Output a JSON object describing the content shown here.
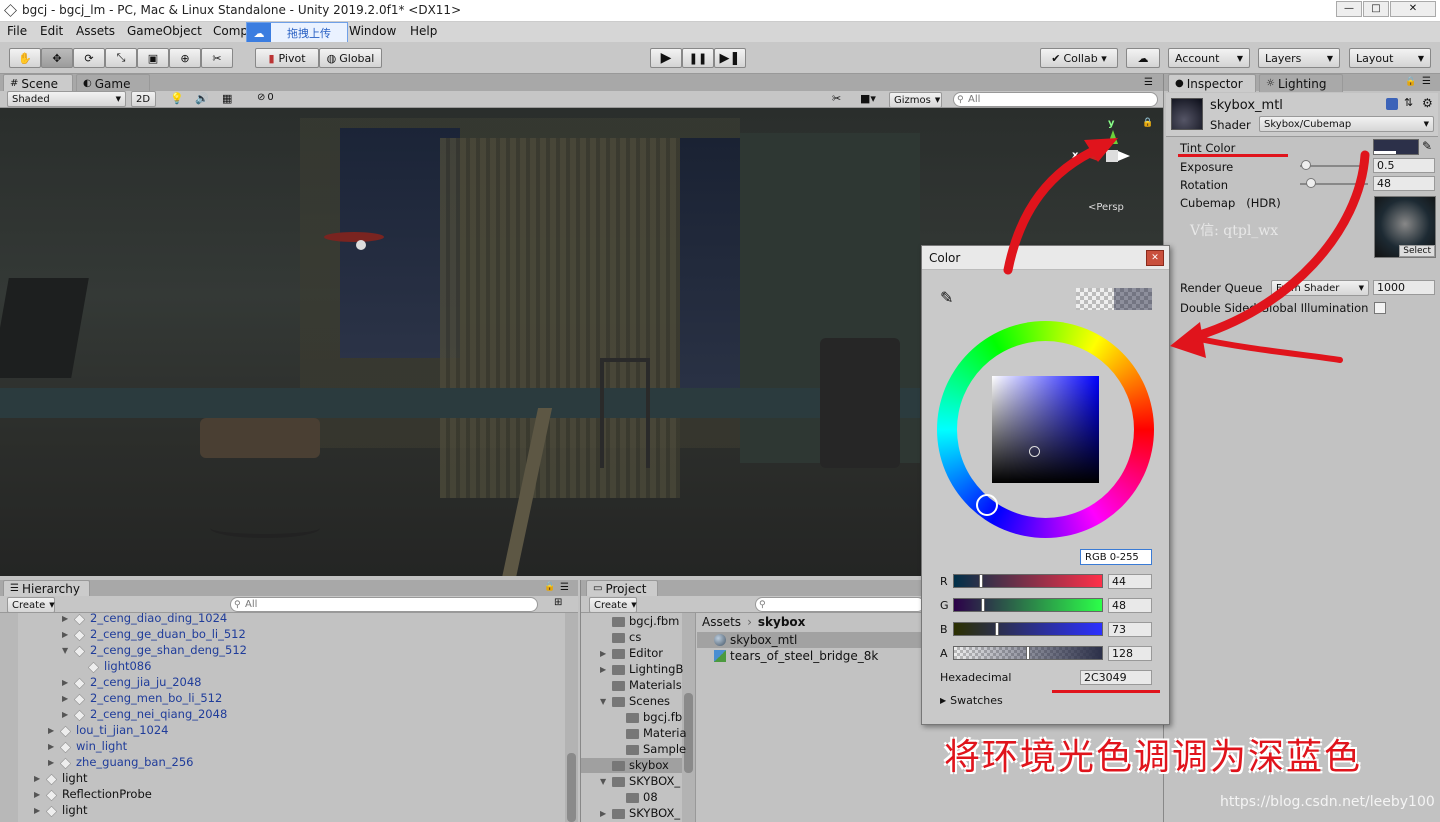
{
  "window": {
    "title": "bgcj - bgcj_lm - PC, Mac & Linux Standalone - Unity 2019.2.0f1* <DX11>",
    "minimize": "—",
    "maximize": "□",
    "close": "✕"
  },
  "menu": {
    "items": [
      "File",
      "Edit",
      "Assets",
      "GameObject",
      "Comp",
      "Window",
      "Help"
    ],
    "upload_badge": "拖拽上传"
  },
  "toolbar": {
    "pivot": "Pivot",
    "global": "Global",
    "collab": "Collab ▾",
    "account": "Account",
    "layers": "Layers",
    "layout": "Layout"
  },
  "scene_panel": {
    "tabs": [
      "Scene",
      "Game"
    ],
    "shading": "Shaded",
    "mode_2d": "2D",
    "hidden_count": "0",
    "gizmos": "Gizmos",
    "search_placeholder": "All",
    "persp": "<Persp",
    "axis_x": "x",
    "axis_y": "y"
  },
  "inspector": {
    "tabs": [
      "Inspector",
      "Lighting"
    ],
    "material_name": "skybox_mtl",
    "shader_label": "Shader",
    "shader_value": "Skybox/Cubemap",
    "props": [
      {
        "label": "Tint Color"
      },
      {
        "label": "Exposure",
        "value": "0.5"
      },
      {
        "label": "Rotation",
        "value": "48"
      },
      {
        "label": "Cubemap   (HDR)"
      }
    ],
    "watermark": "V信: qtpl_wx",
    "select": "Select",
    "render_queue_label": "Render Queue",
    "render_queue_source": "From Shader",
    "render_queue_value": "1000",
    "gi_label": "Double Sided Global Illumination"
  },
  "hierarchy": {
    "tab": "Hierarchy",
    "create": "Create",
    "search_placeholder": "All",
    "items": [
      "2_ceng_diao_ding_1024",
      "2_ceng_ge_duan_bo_li_512",
      "2_ceng_ge_shan_deng_512",
      "light086",
      "2_ceng_jia_ju_2048",
      "2_ceng_men_bo_li_512",
      "2_ceng_nei_qiang_2048",
      "lou_ti_jian_1024",
      "win_light",
      "zhe_guang_ban_256",
      "light",
      "ReflectionProbe",
      "light"
    ]
  },
  "project": {
    "tab": "Project",
    "create": "Create",
    "folders": [
      "bgcj.fbm",
      "cs",
      "Editor",
      "LightingB",
      "Materials",
      "Scenes",
      "bgcj.fb",
      "Materia",
      "Sample",
      "skybox",
      "SKYBOX_",
      "08",
      "SKYBOX_"
    ],
    "breadcrumb_root": "Assets",
    "breadcrumb_current": "skybox",
    "assets": [
      "skybox_mtl",
      "tears_of_steel_bridge_8k"
    ]
  },
  "color_window": {
    "title": "Color",
    "mode": "RGB 0-255",
    "channels": [
      {
        "label": "R",
        "value": "44",
        "fraction": 0.173
      },
      {
        "label": "G",
        "value": "48",
        "fraction": 0.188
      },
      {
        "label": "B",
        "value": "73",
        "fraction": 0.286
      },
      {
        "label": "A",
        "value": "128",
        "fraction": 0.502
      }
    ],
    "hex_label": "Hexadecimal",
    "hex_value": "2C3049",
    "swatches": "Swatches"
  },
  "annotation": {
    "caption": "将环境光色调调为深蓝色",
    "credit": "https://blog.csdn.net/leeby100"
  },
  "colors": {
    "tint": "#2C3049",
    "annotation_red": "#e0141c",
    "hierarchy_blue": "#1f3c9a"
  }
}
